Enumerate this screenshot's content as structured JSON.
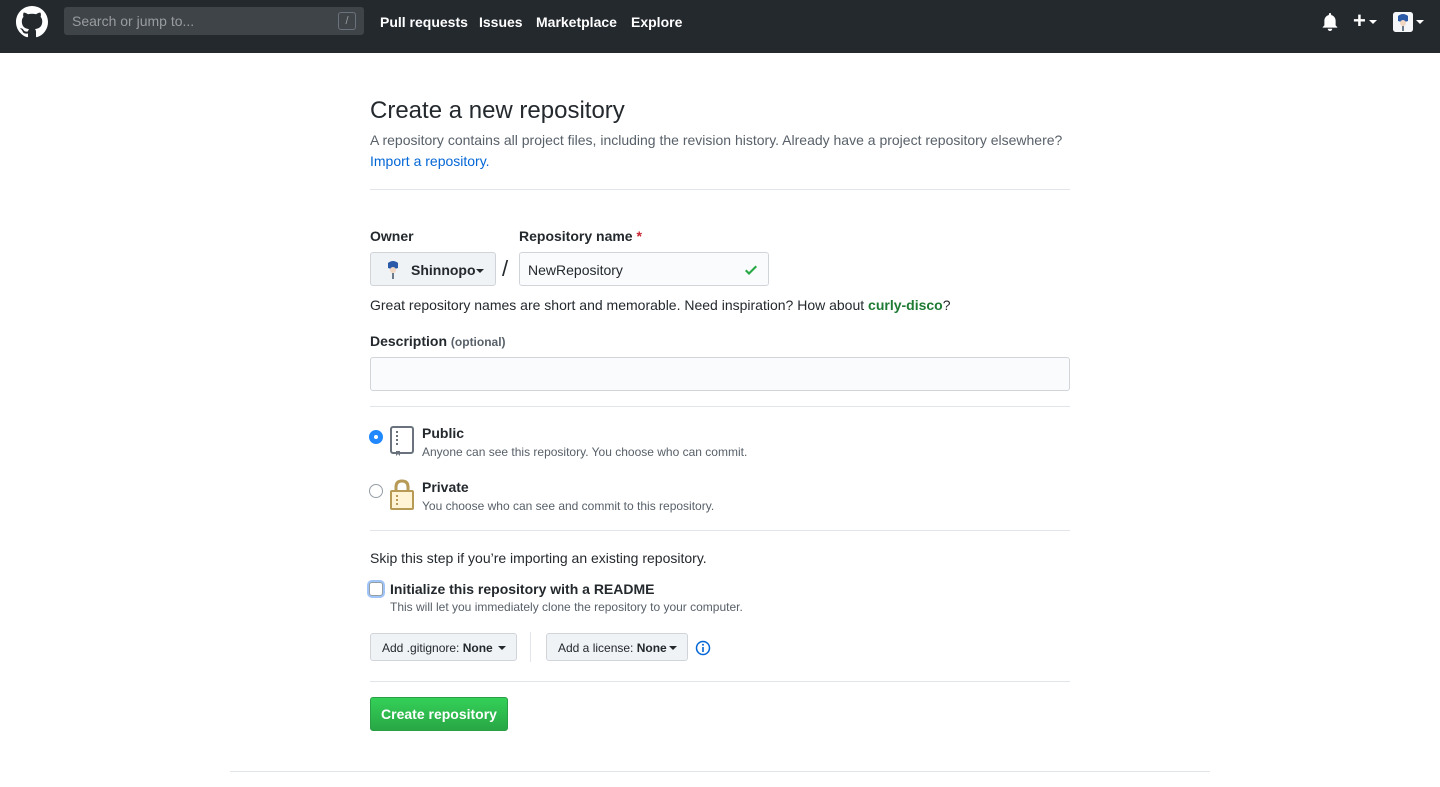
{
  "header": {
    "search_placeholder": "Search or jump to...",
    "search_key": "/",
    "nav": [
      "Pull requests",
      "Issues",
      "Marketplace",
      "Explore"
    ],
    "plus": "+"
  },
  "page": {
    "title": "Create a new repository",
    "subtitle": "A repository contains all project files, including the revision history. Already have a project repository elsewhere?",
    "import_link": "Import a repository."
  },
  "form": {
    "owner_label": "Owner",
    "owner_value": "Shinnopo",
    "repo_label": "Repository name",
    "required_mark": "*",
    "repo_value": "NewRepository",
    "separator": "/",
    "hint_prefix": "Great repository names are short and memorable. Need inspiration? How about ",
    "hint_suggestion": "curly-disco",
    "hint_suffix": "?",
    "description_label": "Description",
    "description_optional": "(optional)",
    "description_value": ""
  },
  "visibility": {
    "selected": "public",
    "public_title": "Public",
    "public_note": "Anyone can see this repository. You choose who can commit.",
    "private_title": "Private",
    "private_note": "You choose who can see and commit to this repository."
  },
  "init": {
    "skip_text": "Skip this step if you’re importing an existing repository.",
    "readme_label": "Initialize this repository with a README",
    "readme_note": "This will let you immediately clone the repository to your computer.",
    "readme_checked": false,
    "gitignore_label": "Add .gitignore:",
    "gitignore_value": "None",
    "license_label": "Add a license:",
    "license_value": "None"
  },
  "actions": {
    "create_label": "Create repository"
  },
  "colors": {
    "header_bg": "#24292e",
    "link": "#0366d6",
    "success": "#28a745",
    "radio_selected": "#2188ff"
  }
}
